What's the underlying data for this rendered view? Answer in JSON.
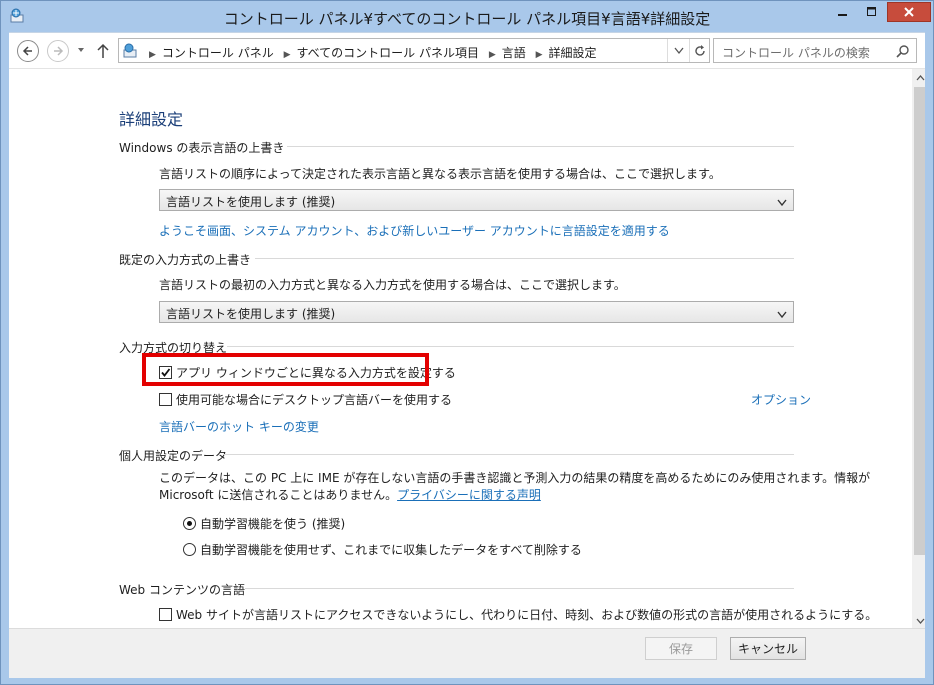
{
  "window": {
    "title": "コントロール パネル¥すべてのコントロール パネル項目¥言語¥詳細設定"
  },
  "nav": {
    "breadcrumbs": [
      "コントロール パネル",
      "すべてのコントロール パネル項目",
      "言語",
      "詳細設定"
    ],
    "search_placeholder": "コントロール パネルの検索"
  },
  "page": {
    "title": "詳細設定",
    "display_language": {
      "heading": "Windows の表示言語の上書き",
      "description": "言語リストの順序によって決定された表示言語と異なる表示言語を使用する場合は、ここで選択します。",
      "select_value": "言語リストを使用します (推奨)",
      "link": "ようこそ画面、システム アカウント、および新しいユーザー アカウントに言語設定を適用する"
    },
    "input_method": {
      "heading": "既定の入力方式の上書き",
      "description": "言語リストの最初の入力方式と異なる入力方式を使用する場合は、ここで選択します。",
      "select_value": "言語リストを使用します (推奨)"
    },
    "switching": {
      "heading": "入力方式の切り替え",
      "per_app_label": "アプリ ウィンドウごとに異なる入力方式を設定する",
      "per_app_checked": true,
      "desktop_bar_label": "使用可能な場合にデスクトップ言語バーを使用する",
      "desktop_bar_checked": false,
      "options_link": "オプション",
      "hotkey_link": "言語バーのホット キーの変更"
    },
    "personalization": {
      "heading": "個人用設定のデータ",
      "text_line1": "このデータは、この PC 上に IME が存在しない言語の手書き認識と予測入力の結果の精度を高めるためにのみ使用されます。情報が",
      "text_line2": "Microsoft に送信されることはありません。",
      "privacy_link": "プライバシーに関する声明",
      "radio_auto": "自動学習機能を使う (推奨)",
      "radio_none": "自動学習機能を使用せず、これまでに収集したデータをすべて削除する"
    },
    "web_content": {
      "heading": "Web コンテンツの言語",
      "checkbox_label": "Web サイトが言語リストにアクセスできないようにし、代わりに日付、時刻、および数値の形式の言語が使用されるようにする。",
      "checked": false
    }
  },
  "footer": {
    "save_label": "保存",
    "cancel_label": "キャンセル"
  },
  "colors": {
    "link": "#1a6fb8",
    "highlight_box": "#e30000",
    "close_button": "#c74c3c",
    "window_frame": "#a9c8ea"
  }
}
